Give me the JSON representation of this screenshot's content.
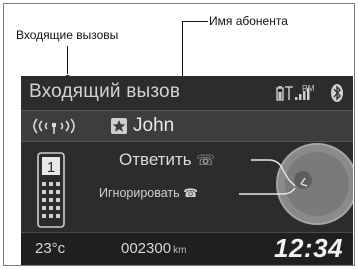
{
  "callouts": {
    "incoming_calls": "Входящие вызовы",
    "caller_name": "Имя абонента"
  },
  "screen": {
    "title": "Входящий вызов",
    "status": {
      "roaming": "RM",
      "icons": [
        "phone-battery-icon",
        "signal-strength-icon",
        "bluetooth-icon"
      ]
    },
    "caller": {
      "name": "John",
      "icons": [
        "incoming-call-wave-icon",
        "favorite-star-icon"
      ]
    },
    "options": {
      "answer": "Ответить",
      "ignore": "Игнорировать"
    },
    "footer": {
      "temperature": "23°c",
      "odometer": "002300",
      "odometer_unit": "km",
      "clock": "12:34"
    }
  },
  "colors": {
    "screen_bg": "#2c2c2c",
    "bar_bg": "#3d3d3d",
    "text": "#dadada"
  }
}
